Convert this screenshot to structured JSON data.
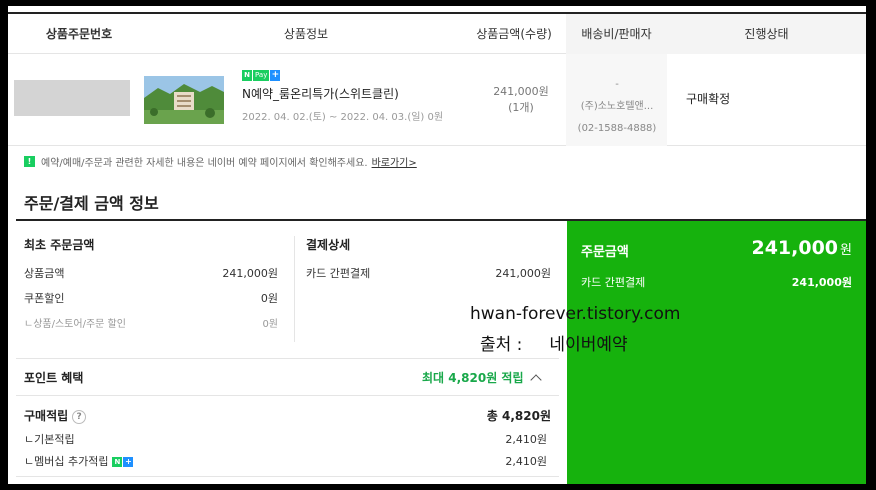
{
  "table": {
    "headers": {
      "order_no": "상품주문번호",
      "product_info": "상품정보",
      "price_qty": "상품금액(수량)",
      "shipping_seller": "배송비/판매자",
      "status": "진행상태"
    },
    "row": {
      "npay_n": "N",
      "npay_pay": "Pay",
      "npay_plus": "+",
      "product_name": "N예약_룸온리특가(스위트클린)",
      "date_range": "2022. 04. 02.(토) ~ 2022. 04. 03.(일) 0원",
      "price": "241,000원",
      "quantity": "(1개)",
      "shipping_fee": "-",
      "seller": "(주)소노호텔앤...",
      "seller_phone": "(02-1588-4888)",
      "status": "구매확정"
    }
  },
  "notice": {
    "icon": "!",
    "text": "예약/예매/주문과 관련한 자세한 내용은 네이버 예약 페이지에서 확인해주세요.",
    "link": "바로가기>"
  },
  "section_title": "주문/결제 금액 정보",
  "initial_amount": {
    "title": "최초 주문금액",
    "rows": [
      {
        "label": "상품금액",
        "value": "241,000원"
      },
      {
        "label": "쿠폰할인",
        "value": "0원"
      },
      {
        "label": "ㄴ상품/스토어/주문 할인",
        "value": "0원"
      }
    ]
  },
  "payment_detail": {
    "title": "결제상세",
    "rows": [
      {
        "label": "카드 간편결제",
        "value": "241,000원"
      }
    ]
  },
  "points": {
    "title": "포인트 혜택",
    "max_label": "최대 4,820원 적립",
    "accrual_label": "구매적립",
    "help_icon": "?",
    "accrual_total": "총 4,820원",
    "rows": [
      {
        "label": "ㄴ기본적립",
        "value": "2,410원"
      },
      {
        "label": "ㄴ멤버십 추가적립",
        "value": "2,410원"
      }
    ]
  },
  "order_total": {
    "label": "주문금액",
    "amount": "241,000",
    "unit": "원",
    "method_label": "카드 간편결제",
    "method_value": "241,000원"
  },
  "watermark": {
    "line1": "hwan-forever.tistory.com",
    "line2": "출처 :     네이버예약"
  },
  "colors": {
    "accent_green": "#16b20d",
    "npay_green": "#19ce60",
    "point_green": "#19a84a"
  },
  "icons": [
    "npay-icon",
    "notice-exclamation-icon",
    "chevron-up-icon",
    "help-icon"
  ]
}
